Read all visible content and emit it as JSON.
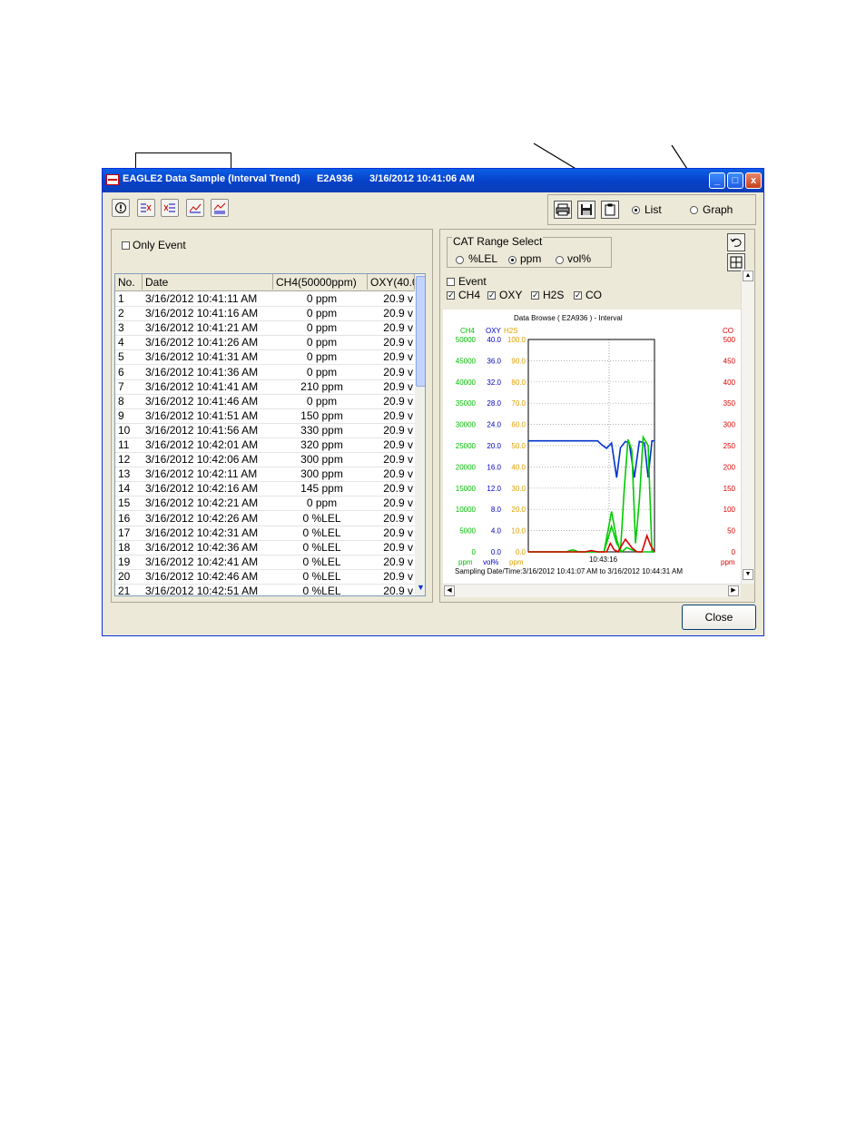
{
  "window": {
    "title": "EAGLE2 Data Sample (Interval Trend)      E2A936      3/16/2012 10:41:06 AM",
    "minimize": "_",
    "maximize": "□",
    "close": "x"
  },
  "view_mode": {
    "list_label": "List",
    "graph_label": "Graph",
    "selected": "List"
  },
  "left": {
    "only_event_label": "Only Event",
    "columns": [
      "No.",
      "Date",
      "CH4(50000ppm)",
      "OXY(40.0"
    ],
    "rows": [
      [
        "1",
        "3/16/2012 10:41:11 AM",
        "0 ppm",
        "20.9 v"
      ],
      [
        "2",
        "3/16/2012 10:41:16 AM",
        "0 ppm",
        "20.9 v"
      ],
      [
        "3",
        "3/16/2012 10:41:21 AM",
        "0 ppm",
        "20.9 v"
      ],
      [
        "4",
        "3/16/2012 10:41:26 AM",
        "0 ppm",
        "20.9 v"
      ],
      [
        "5",
        "3/16/2012 10:41:31 AM",
        "0 ppm",
        "20.9 v"
      ],
      [
        "6",
        "3/16/2012 10:41:36 AM",
        "0 ppm",
        "20.9 v"
      ],
      [
        "7",
        "3/16/2012 10:41:41 AM",
        "210 ppm",
        "20.9 v"
      ],
      [
        "8",
        "3/16/2012 10:41:46 AM",
        "0 ppm",
        "20.9 v"
      ],
      [
        "9",
        "3/16/2012 10:41:51 AM",
        "150 ppm",
        "20.9 v"
      ],
      [
        "10",
        "3/16/2012 10:41:56 AM",
        "330 ppm",
        "20.9 v"
      ],
      [
        "11",
        "3/16/2012 10:42:01 AM",
        "320 ppm",
        "20.9 v"
      ],
      [
        "12",
        "3/16/2012 10:42:06 AM",
        "300 ppm",
        "20.9 v"
      ],
      [
        "13",
        "3/16/2012 10:42:11 AM",
        "300 ppm",
        "20.9 v"
      ],
      [
        "14",
        "3/16/2012 10:42:16 AM",
        "145 ppm",
        "20.9 v"
      ],
      [
        "15",
        "3/16/2012 10:42:21 AM",
        "0 ppm",
        "20.9 v"
      ],
      [
        "16",
        "3/16/2012 10:42:26 AM",
        "0 %LEL",
        "20.9 v"
      ],
      [
        "17",
        "3/16/2012 10:42:31 AM",
        "0 %LEL",
        "20.9 v"
      ],
      [
        "18",
        "3/16/2012 10:42:36 AM",
        "0 %LEL",
        "20.9 v"
      ],
      [
        "19",
        "3/16/2012 10:42:41 AM",
        "0 %LEL",
        "20.9 v"
      ],
      [
        "20",
        "3/16/2012 10:42:46 AM",
        "0 %LEL",
        "20.9 v"
      ],
      [
        "21",
        "3/16/2012 10:42:51 AM",
        "0 %LEL",
        "20.9 v"
      ]
    ]
  },
  "right": {
    "cat_range_label": "CAT Range Select",
    "cat_options": [
      "%LEL",
      "ppm",
      "vol%"
    ],
    "cat_selected": "ppm",
    "event_label": "Event",
    "gases": [
      "CH4",
      "OXY",
      "H2S",
      "CO"
    ]
  },
  "close_button": "Close",
  "chart_data": {
    "type": "line",
    "title": "Data Browse (      E2A936      ) - Interval",
    "x_tick": "10:43:16",
    "footer": "Sampling Date/Time:3/16/2012 10:41:07 AM to 3/16/2012 10:44:31 AM",
    "axes": {
      "ch4": {
        "label": "CH4",
        "unit": "ppm",
        "ticks": [
          "50000",
          "45000",
          "40000",
          "35000",
          "30000",
          "25000",
          "20000",
          "15000",
          "10000",
          "5000",
          "0"
        ],
        "color": "#00c000"
      },
      "oxy": {
        "label": "OXY",
        "unit": "vol%",
        "ticks": [
          "40.0",
          "36.0",
          "32.0",
          "28.0",
          "24.0",
          "20.0",
          "16.0",
          "12.0",
          "8.0",
          "4.0",
          "0.0"
        ],
        "color": "#0000c0"
      },
      "h2s": {
        "label": "H2S",
        "unit": "ppm",
        "ticks": [
          "100.0",
          "90.0",
          "80.0",
          "70.0",
          "60.0",
          "50.0",
          "40.0",
          "30.0",
          "20.0",
          "10.0",
          "0.0"
        ],
        "color": "#e0a000"
      },
      "co": {
        "label": "CO",
        "unit": "ppm",
        "ticks": [
          "500",
          "450",
          "400",
          "350",
          "300",
          "250",
          "200",
          "150",
          "100",
          "50",
          "0"
        ],
        "color": "#e00000"
      }
    },
    "series": [
      {
        "name": "OXY",
        "color": "#0033cc",
        "points": [
          [
            0,
            20.9
          ],
          [
            0.55,
            20.9
          ],
          [
            0.58,
            20.2
          ],
          [
            0.62,
            19.5
          ],
          [
            0.66,
            20.5
          ],
          [
            0.7,
            14
          ],
          [
            0.73,
            19.6
          ],
          [
            0.77,
            20.8
          ],
          [
            0.8,
            20.5
          ],
          [
            0.84,
            14
          ],
          [
            0.88,
            20.8
          ],
          [
            0.92,
            20.5
          ],
          [
            0.95,
            14
          ],
          [
            0.98,
            20.9
          ],
          [
            1,
            20.9
          ]
        ]
      },
      {
        "name": "CH4",
        "color": "#00cc00",
        "points": [
          [
            0,
            0
          ],
          [
            0.6,
            0
          ],
          [
            0.66,
            9500
          ],
          [
            0.7,
            3000
          ],
          [
            0.73,
            0
          ],
          [
            0.76,
            14500
          ],
          [
            0.79,
            26500
          ],
          [
            0.82,
            24000
          ],
          [
            0.85,
            2000
          ],
          [
            0.88,
            12000
          ],
          [
            0.91,
            27000
          ],
          [
            0.95,
            25000
          ],
          [
            0.98,
            0
          ],
          [
            1,
            0
          ]
        ]
      },
      {
        "name": "H2S",
        "color": "#00cc00",
        "points": [
          [
            0,
            0
          ],
          [
            0.3,
            0
          ],
          [
            0.35,
            1
          ],
          [
            0.4,
            0
          ],
          [
            0.6,
            0
          ],
          [
            0.66,
            12
          ],
          [
            0.7,
            4
          ],
          [
            0.74,
            0
          ],
          [
            0.78,
            2
          ],
          [
            0.82,
            1
          ],
          [
            0.87,
            0
          ],
          [
            1,
            0
          ]
        ]
      },
      {
        "name": "CO",
        "color": "#dd0000",
        "points": [
          [
            0,
            0
          ],
          [
            0.45,
            0
          ],
          [
            0.5,
            3
          ],
          [
            0.55,
            0
          ],
          [
            0.62,
            0
          ],
          [
            0.65,
            20
          ],
          [
            0.68,
            5
          ],
          [
            0.71,
            0
          ],
          [
            0.77,
            30
          ],
          [
            0.82,
            10
          ],
          [
            0.86,
            0
          ],
          [
            0.9,
            0
          ],
          [
            0.94,
            38
          ],
          [
            0.97,
            15
          ],
          [
            1,
            0
          ]
        ]
      }
    ]
  }
}
